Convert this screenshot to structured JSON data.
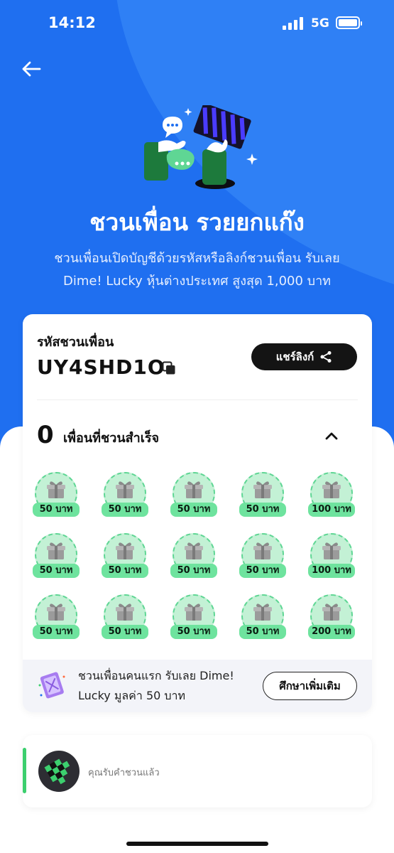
{
  "status_bar": {
    "time": "14:12",
    "network": "5G"
  },
  "hero": {
    "title": "ชวนเพื่อน รวยยกแก๊ง",
    "subtitle_line1": "ชวนเพื่อนเปิดบัญชีด้วยรหัสหรือลิงก์ชวนเพื่อน รับเลย",
    "subtitle_line2": "Dime! Lucky หุ้นต่างประเทศ สูงสุด 1,000 บาท"
  },
  "referral": {
    "code_label": "รหัสชวนเพื่อน",
    "code": "UY4SHD1O",
    "share_label": "แชร์ลิงก์"
  },
  "friends": {
    "count": "0",
    "label": "เพื่อนที่ชวนสำเร็จ"
  },
  "rewards": [
    "50 บาท",
    "50 บาท",
    "50 บาท",
    "50 บาท",
    "100 บาท",
    "50 บาท",
    "50 บาท",
    "50 บาท",
    "50 บาท",
    "100 บาท",
    "50 บาท",
    "50 บาท",
    "50 บาท",
    "50 บาท",
    "200 บาท"
  ],
  "info": {
    "line1": "ชวนเพื่อนคนแรก รับเลย Dime!",
    "line2": "Lucky มูลค่า 50 บาท",
    "button": "ศึกษาเพิ่มเติม"
  },
  "accepted": {
    "label": "คุณรับคำชวนแล้ว"
  },
  "colors": {
    "hero_blue": "#1f6ff0",
    "reward_green": "#6ee39e",
    "accent_green": "#3ccf6e"
  }
}
